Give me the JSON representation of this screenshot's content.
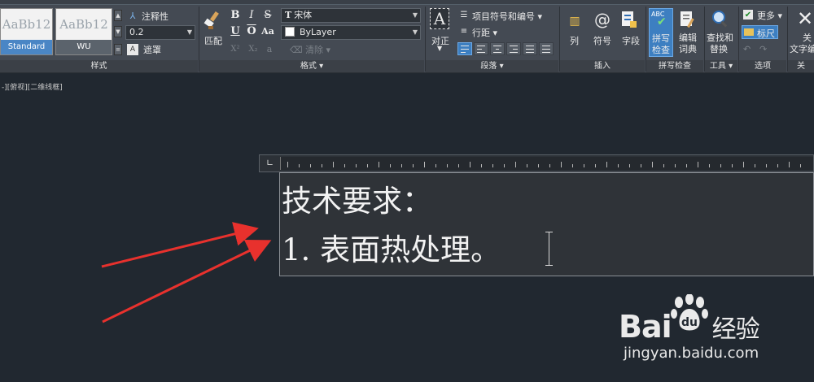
{
  "ribbon": {
    "styles_panel": {
      "title": "样式",
      "tiles": [
        {
          "sample": "AaBb12",
          "name": "Standard",
          "selected": true
        },
        {
          "sample": "AaBb12",
          "name": "WU",
          "selected": false
        }
      ],
      "annotative_label": "注释性",
      "height_value": "0.2",
      "mask_label": "遮罩"
    },
    "format_panel": {
      "title": "格式",
      "match_label": "匹配",
      "bold": "B",
      "italic": "I",
      "strike": "S",
      "underline": "U",
      "overline": "O",
      "case": "Aa",
      "superscript": "X²",
      "subscript": "X₂",
      "oblique_angle": "a",
      "clear_label": "清除",
      "font_value": "宋体",
      "color_value": "ByLayer"
    },
    "paragraph_panel": {
      "title": "段落",
      "justify_label": "对正",
      "bullets_label": "项目符号和编号",
      "linespacing_label": "行距"
    },
    "insert_panel": {
      "title": "插入",
      "columns_label": "列",
      "symbol_label": "符号",
      "field_label": "字段"
    },
    "spell_panel": {
      "title": "拼写检查",
      "spellcheck_line1": "拼写",
      "spellcheck_line2": "检查",
      "dictionary_line1": "编辑",
      "dictionary_line2": "词典",
      "spell_icon_text": "ABC"
    },
    "tools_panel": {
      "title": "工具",
      "find_line1": "查找和",
      "find_line2": "替换"
    },
    "options_panel": {
      "title": "选项",
      "more_label": "更多",
      "ruler_label": "标尺"
    },
    "close_panel": {
      "title": "关",
      "close_line1": "关",
      "close_line2": "文字编"
    }
  },
  "viewport_label": "-][俯视][二维线框]",
  "editor": {
    "lines": [
      "技术要求：",
      "1. 表面热处理。"
    ]
  },
  "watermark": {
    "brand": "Bai",
    "brand_tail": "经验",
    "url": "jingyan.baidu.com"
  },
  "colors": {
    "background": "#212830",
    "ribbon": "#444a53",
    "accent": "#3d7fc1",
    "arrow": "#e8312d"
  },
  "icons": [
    "paintbrush-icon",
    "text-style-icon",
    "justify-icon",
    "list-icon",
    "columns-icon",
    "at-symbol-icon",
    "field-icon",
    "spellcheck-icon",
    "dictionary-icon",
    "find-replace-icon",
    "ruler-icon",
    "undo-icon",
    "redo-icon",
    "close-icon",
    "arrow-icon",
    "paw-icon"
  ]
}
